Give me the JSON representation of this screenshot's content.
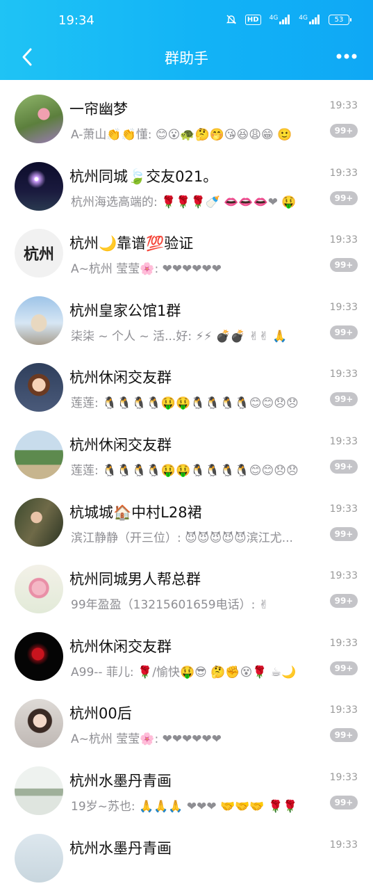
{
  "status_bar": {
    "time": "19:34",
    "hd_label": "HD",
    "net1": "4G",
    "net2": "4G",
    "battery": "53"
  },
  "header": {
    "title": "群助手"
  },
  "chats": [
    {
      "name": "一帘幽梦",
      "preview": "A-萧山👏👏懂: 😊😮🐢🤔🤭😘😆😩😁 🙂",
      "time": "19:33",
      "unread": "99+"
    },
    {
      "name": "杭州同城🍃交友021。",
      "preview": "杭州海选高端的: 🌹🌹🌹🍼 👄👄👄❤ 🤑",
      "time": "19:33",
      "unread": "99+"
    },
    {
      "name": "杭州🌙靠谱💯验证",
      "preview": "A~杭州  莹莹🌸: ❤❤❤❤❤❤",
      "time": "19:33",
      "unread": "99+"
    },
    {
      "name": "杭州皇家公馆1群",
      "preview": "柒柒 ~ 个人 ~ 活...好: ⚡⚡ 💣💣 ✌✌ 🙏",
      "time": "19:33",
      "unread": "99+"
    },
    {
      "name": "杭州休闲交友群",
      "preview": "莲莲: 🐧🐧🐧🐧🤑🤑🐧🐧🐧🐧😊😊😞😞",
      "time": "19:33",
      "unread": "99+"
    },
    {
      "name": "杭州休闲交友群",
      "preview": "莲莲: 🐧🐧🐧🐧🤑🤑🐧🐧🐧🐧😊😊😞😞",
      "time": "19:33",
      "unread": "99+"
    },
    {
      "name": "杭城城🏠中村L28裙",
      "preview": "滨江静静（开三位）: 😈😈😈😈😈滨江尤...",
      "time": "19:33",
      "unread": "99+"
    },
    {
      "name": "杭州同城男人帮总群",
      "preview": "99年盈盈（13215601659电话）: ✌",
      "time": "19:33",
      "unread": "99+"
    },
    {
      "name": "杭州休闲交友群",
      "preview": "A99-- 菲儿: 🌹/愉快🤑😎 🤔✊😵🌹 ☕🌙",
      "time": "19:33",
      "unread": "99+"
    },
    {
      "name": "杭州00后",
      "preview": "A~杭州  莹莹🌸: ❤❤❤❤❤❤",
      "time": "19:33",
      "unread": "99+"
    },
    {
      "name": "杭州水墨丹青画",
      "preview": "19岁~苏也: 🙏🙏🙏 ❤❤❤ 🤝🤝🤝 🌹🌹",
      "time": "19:33",
      "unread": "99+"
    },
    {
      "name": "杭州水墨丹青画",
      "preview": "",
      "time": "19:33",
      "unread": ""
    }
  ]
}
